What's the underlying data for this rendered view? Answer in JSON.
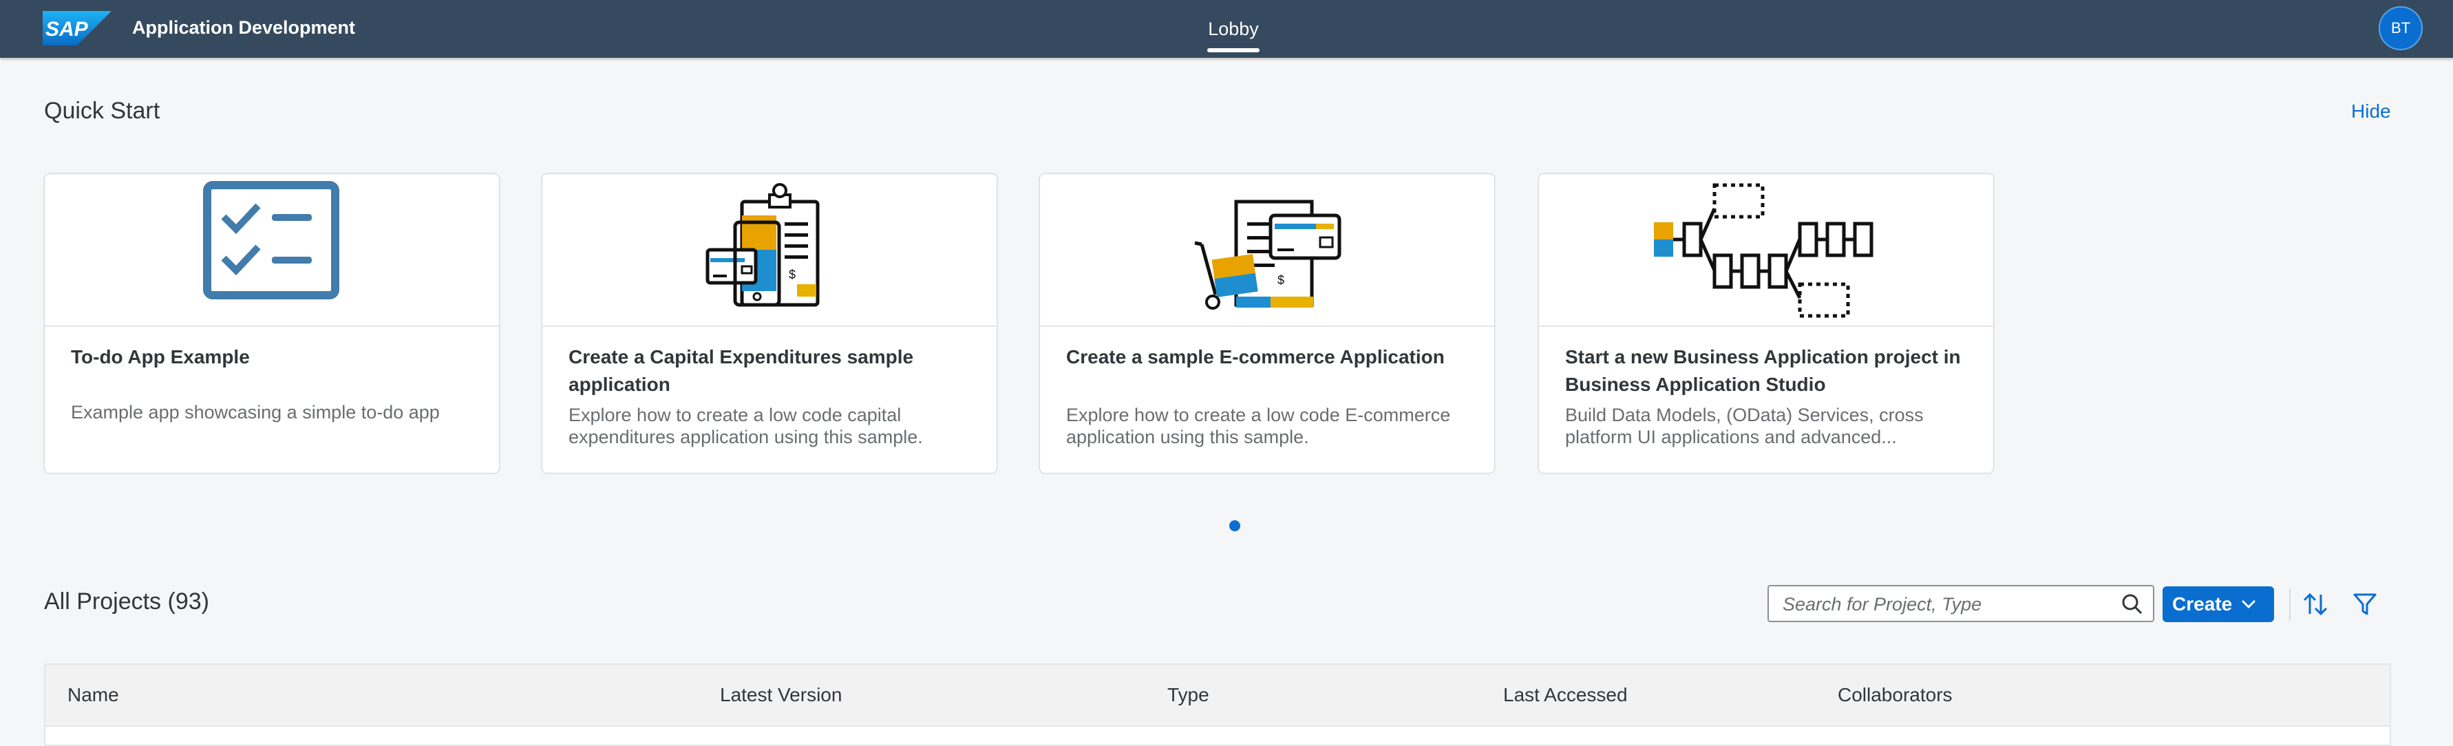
{
  "shell": {
    "logo_text": "SAP",
    "app_title": "Application Development",
    "tab_label": "Lobby",
    "avatar_initials": "BT"
  },
  "quick_start": {
    "title": "Quick Start",
    "hide_label": "Hide",
    "cards": [
      {
        "title": "To-do App Example",
        "description": "Example app showcasing a simple to-do app",
        "icon": "todo-checklist-icon"
      },
      {
        "title": "Create a Capital Expenditures sample application",
        "description": "Explore how to create a low code capital expenditures application using this sample.",
        "icon": "capital-expenditures-icon"
      },
      {
        "title": "Create a sample E-commerce Application",
        "description": "Explore how to create a low code E-commerce application using this sample.",
        "icon": "ecommerce-icon"
      },
      {
        "title": "Start a new Business Application project in Business Application Studio",
        "description": "Build Data Models, (OData) Services, cross platform UI applications and advanced...",
        "icon": "business-application-icon"
      }
    ]
  },
  "projects": {
    "title": "All Projects (93)",
    "search_placeholder": "Search for Project, Type",
    "create_label": "Create",
    "columns": [
      "Name",
      "Latest Version",
      "Type",
      "Last Accessed",
      "Collaborators"
    ]
  },
  "colors": {
    "shell_bg": "#354a5f",
    "accent": "#0a6ed1",
    "icon_blue": "#427cac"
  }
}
